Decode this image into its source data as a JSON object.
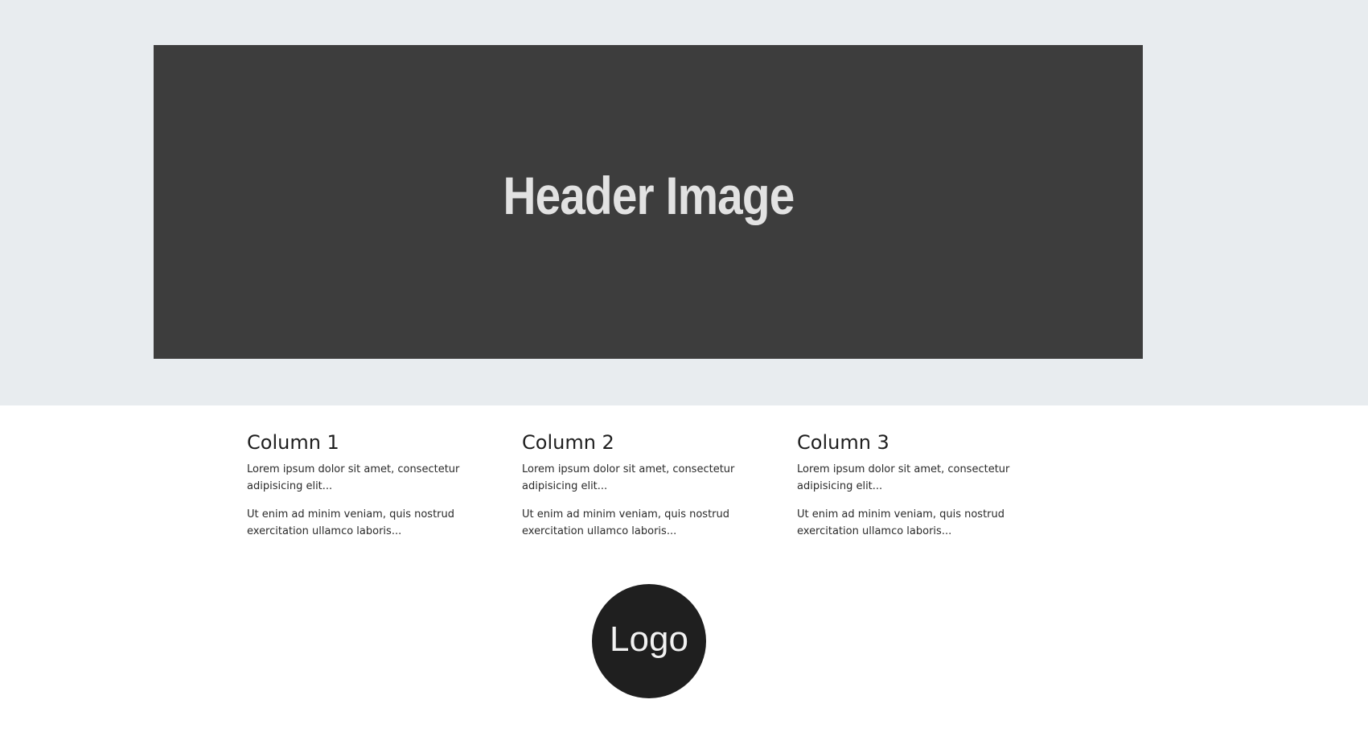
{
  "header": {
    "image_label": "Header Image"
  },
  "columns": [
    {
      "title": "Column 1",
      "paragraph_1": "Lorem ipsum dolor sit amet, consectetur adipisicing elit...",
      "paragraph_2": "Ut enim ad minim veniam, quis nostrud exercitation ullamco laboris..."
    },
    {
      "title": "Column 2",
      "paragraph_1": "Lorem ipsum dolor sit amet, consectetur adipisicing elit...",
      "paragraph_2": "Ut enim ad minim veniam, quis nostrud exercitation ullamco laboris..."
    },
    {
      "title": "Column 3",
      "paragraph_1": "Lorem ipsum dolor sit amet, consectetur adipisicing elit...",
      "paragraph_2": "Ut enim ad minim veniam, quis nostrud exercitation ullamco laboris..."
    }
  ],
  "footer": {
    "logo_label": "Logo"
  },
  "colors": {
    "band_background": "#e8ecef",
    "header_image_background": "#3d3d3d",
    "logo_background": "#1f1f1f"
  }
}
